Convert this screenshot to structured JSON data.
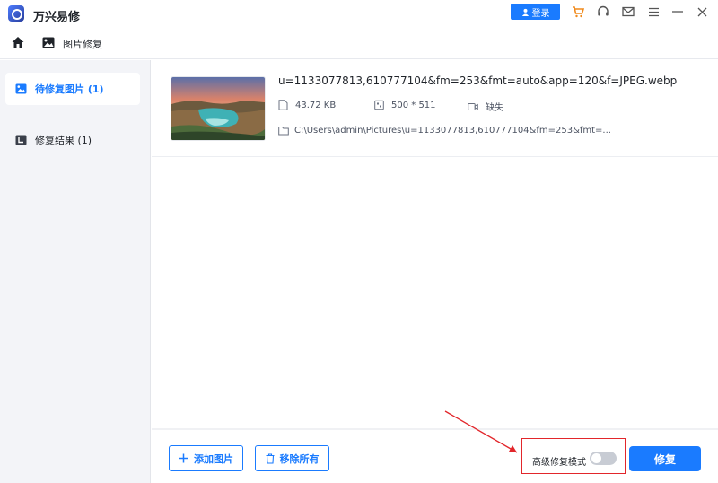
{
  "app": {
    "title": "万兴易修",
    "login_label": "登录"
  },
  "nav": {
    "current_label": "图片修复"
  },
  "sidebar": {
    "items": [
      {
        "label": "待修复图片 (1)",
        "active": true
      },
      {
        "label": "修复结果 (1)",
        "active": false
      }
    ]
  },
  "file": {
    "name": "u=1133077813,610777104&fm=253&fmt=auto&app=120&f=JPEG.webp",
    "size": "43.72 KB",
    "dimensions": "500 * 511",
    "status": "缺失",
    "path": "C:\\Users\\admin\\Pictures\\u=1133077813,610777104&fm=253&fmt=..."
  },
  "bottom": {
    "add_label": "添加图片",
    "remove_label": "移除所有",
    "advanced_label": "高级修复模式",
    "advanced_enabled": false,
    "repair_label": "修复"
  },
  "colors": {
    "accent": "#1a7bff",
    "highlight": "#e2262b"
  }
}
